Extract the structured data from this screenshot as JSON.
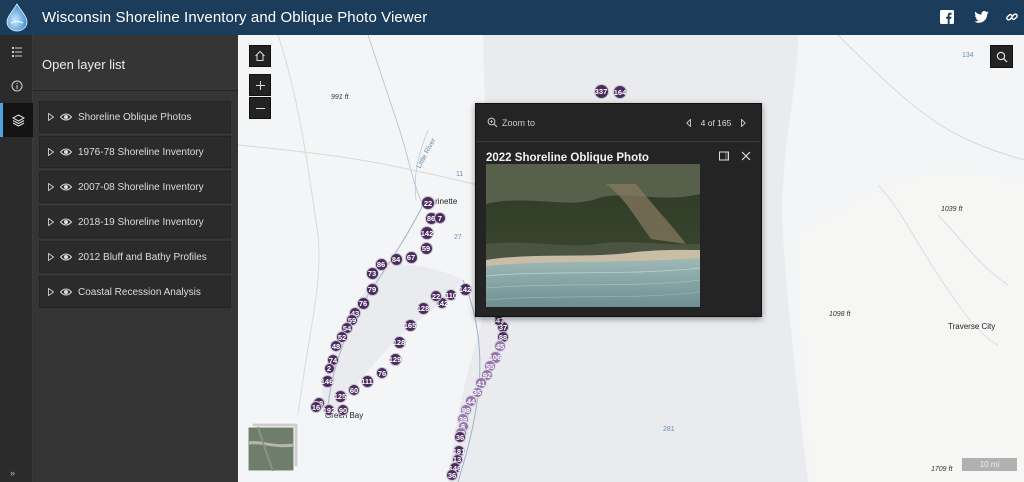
{
  "app": {
    "title": "Wisconsin Shoreline Inventory and Oblique Photo Viewer"
  },
  "header": {
    "icons": [
      "facebook-icon",
      "twitter-icon",
      "link-icon"
    ]
  },
  "rail": {
    "items": [
      "legend-icon",
      "info-icon",
      "layers-icon"
    ],
    "active": "layers-icon"
  },
  "panel": {
    "title": "Open layer list",
    "layers": [
      {
        "label": "Shoreline Oblique Photos"
      },
      {
        "label": "1976-78 Shoreline Inventory"
      },
      {
        "label": "2007-08 Shoreline Inventory"
      },
      {
        "label": "2018-19 Shoreline Inventory"
      },
      {
        "label": "2012 Bluff and Bathy Profiles"
      },
      {
        "label": "Coastal Recession Analysis"
      }
    ],
    "collapse_label": "»"
  },
  "map": {
    "labels": {
      "elev_991": "991 ft",
      "elev_1039": "1039 ft",
      "elev_1098": "1098 ft",
      "elev_1709": "1709 ft",
      "road_134": "134",
      "road_11": "11",
      "road_27": "27",
      "road_281": "281",
      "river": "Little River",
      "marinette": "Marinette",
      "green_bay": "Green Bay",
      "traverse": "Traverse City"
    },
    "clusters": [
      "337",
      "164",
      "22",
      "86",
      "7",
      "142",
      "59",
      "67",
      "84",
      "86",
      "73",
      "79",
      "76",
      "43",
      "59",
      "54",
      "52",
      "48",
      "74",
      "2",
      "146",
      "88",
      "16",
      "192",
      "90",
      "125",
      "60",
      "111",
      "76",
      "129",
      "128",
      "165",
      "128",
      "142",
      "22",
      "110",
      "142",
      "37",
      "88",
      "45",
      "106",
      "55",
      "92",
      "41",
      "35",
      "44",
      "98",
      "39",
      "8",
      "38",
      "36",
      "181",
      "13",
      "146",
      "36",
      "347"
    ],
    "scale_label": "10 mi"
  },
  "popup": {
    "zoom_label": "Zoom to",
    "pager_text": "4 of 165",
    "title": "2022 Shoreline Oblique Photo"
  }
}
